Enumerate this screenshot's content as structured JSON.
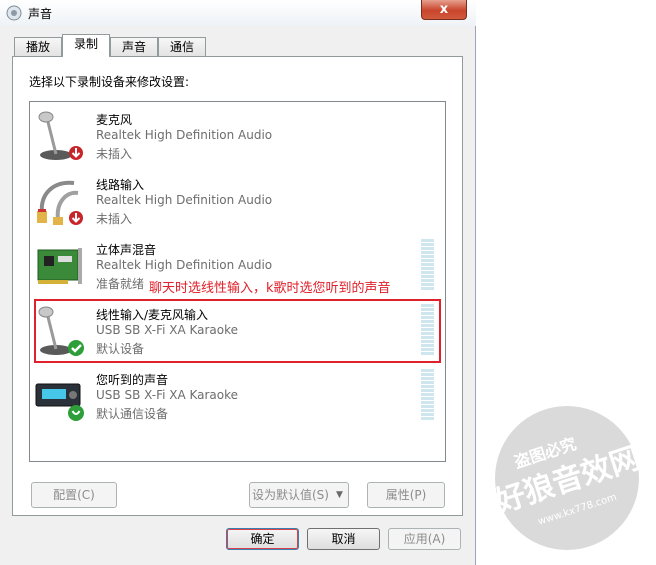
{
  "window": {
    "title": "声音",
    "close_glyph": "x"
  },
  "tabs": [
    {
      "label": "播放"
    },
    {
      "label": "录制"
    },
    {
      "label": "声音"
    },
    {
      "label": "通信"
    }
  ],
  "panel": {
    "instruction": "选择以下录制设备来修改设置:"
  },
  "devices": [
    {
      "name": "麦克风",
      "driver": "Realtek High Definition Audio",
      "status": "未插入",
      "icon": "microphone-icon"
    },
    {
      "name": "线路输入",
      "driver": "Realtek High Definition Audio",
      "status": "未插入",
      "icon": "line-in-cable-icon"
    },
    {
      "name": "立体声混音",
      "driver": "Realtek High Definition Audio",
      "status": "准备就绪",
      "icon": "sound-card-icon"
    },
    {
      "name": "线性输入/麦克风输入",
      "driver": "USB SB X-Fi XA Karaoke",
      "status": "默认设备",
      "icon": "microphone-icon"
    },
    {
      "name": "您听到的声音",
      "driver": "USB SB X-Fi XA Karaoke",
      "status": "默认通信设备",
      "icon": "audio-device-icon"
    }
  ],
  "annotation": {
    "text": "聊天时选线性输入，k歌时选您听到的声音"
  },
  "panel_buttons": {
    "configure": "配置(C)",
    "set_default": "设为默认值(S)",
    "properties": "属性(P)"
  },
  "footer_buttons": {
    "ok": "确定",
    "cancel": "取消",
    "apply": "应用(A)"
  },
  "watermark": {
    "line1": "盗图必究",
    "line2": "好狼音效网",
    "url": "www.kx778.com"
  },
  "colors": {
    "annotation": "#e0202a",
    "meter": "#cfe6ee",
    "title_close": "#c8452b"
  }
}
